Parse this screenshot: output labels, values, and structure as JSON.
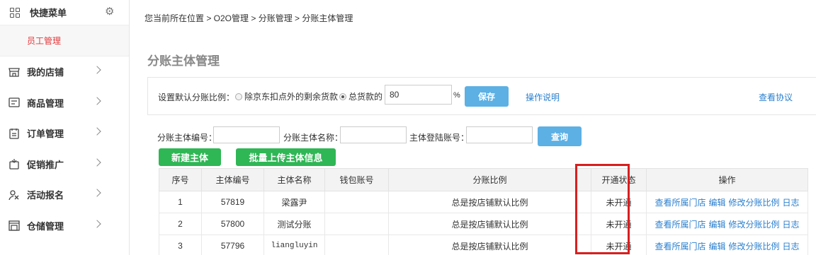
{
  "sidebar": {
    "quick_menu_title": "快捷菜单",
    "sub_item": "员工管理",
    "items": [
      {
        "label": "我的店铺",
        "icon": "store-icon"
      },
      {
        "label": "商品管理",
        "icon": "goods-icon"
      },
      {
        "label": "订单管理",
        "icon": "order-icon"
      },
      {
        "label": "促销推广",
        "icon": "promotion-icon"
      },
      {
        "label": "活动报名",
        "icon": "activity-icon"
      },
      {
        "label": "仓储管理",
        "icon": "warehouse-icon"
      }
    ]
  },
  "breadcrumb": "您当前所在位置 > O2O管理 > 分账管理 > 分账主体管理",
  "page_title": "分账主体管理",
  "settings": {
    "label": "设置默认分账比例：",
    "radio1": "除京东扣点外的剩余货款",
    "radio2": "总货款的",
    "percent_value": "80",
    "percent_sign": "%",
    "save_label": "保存",
    "help_link": "操作说明",
    "agreement_link": "查看协议"
  },
  "filters": {
    "code_label": "分账主体编号：",
    "name_label": "分账主体名称：",
    "login_label": "主体登陆账号：",
    "query_label": "查询"
  },
  "actions": {
    "create_label": "新建主体",
    "batch_upload_label": "批量上传主体信息"
  },
  "table": {
    "headers": [
      "序号",
      "主体编号",
      "主体名称",
      "钱包账号",
      "分账比例",
      "开通状态",
      "操作"
    ],
    "rows": [
      {
        "index": "1",
        "code": "57819",
        "name": "梁露尹",
        "wallet": "",
        "ratio": "总是按店铺默认比例",
        "status": "未开通"
      },
      {
        "index": "2",
        "code": "57800",
        "name": "测试分账",
        "wallet": "",
        "ratio": "总是按店铺默认比例",
        "status": "未开通"
      },
      {
        "index": "3",
        "code": "57796",
        "name": "liangluyin",
        "wallet": "",
        "ratio": "总是按店铺默认比例",
        "status": "未开通"
      }
    ],
    "ops": [
      "查看所属门店",
      "编辑",
      "修改分账比例",
      "日志"
    ]
  },
  "colors": {
    "accent_red": "#e4393c",
    "link_blue": "#2a7fce",
    "button_blue": "#5cb0e4",
    "button_green": "#2fb655",
    "highlight_box": "#d91e1e"
  }
}
